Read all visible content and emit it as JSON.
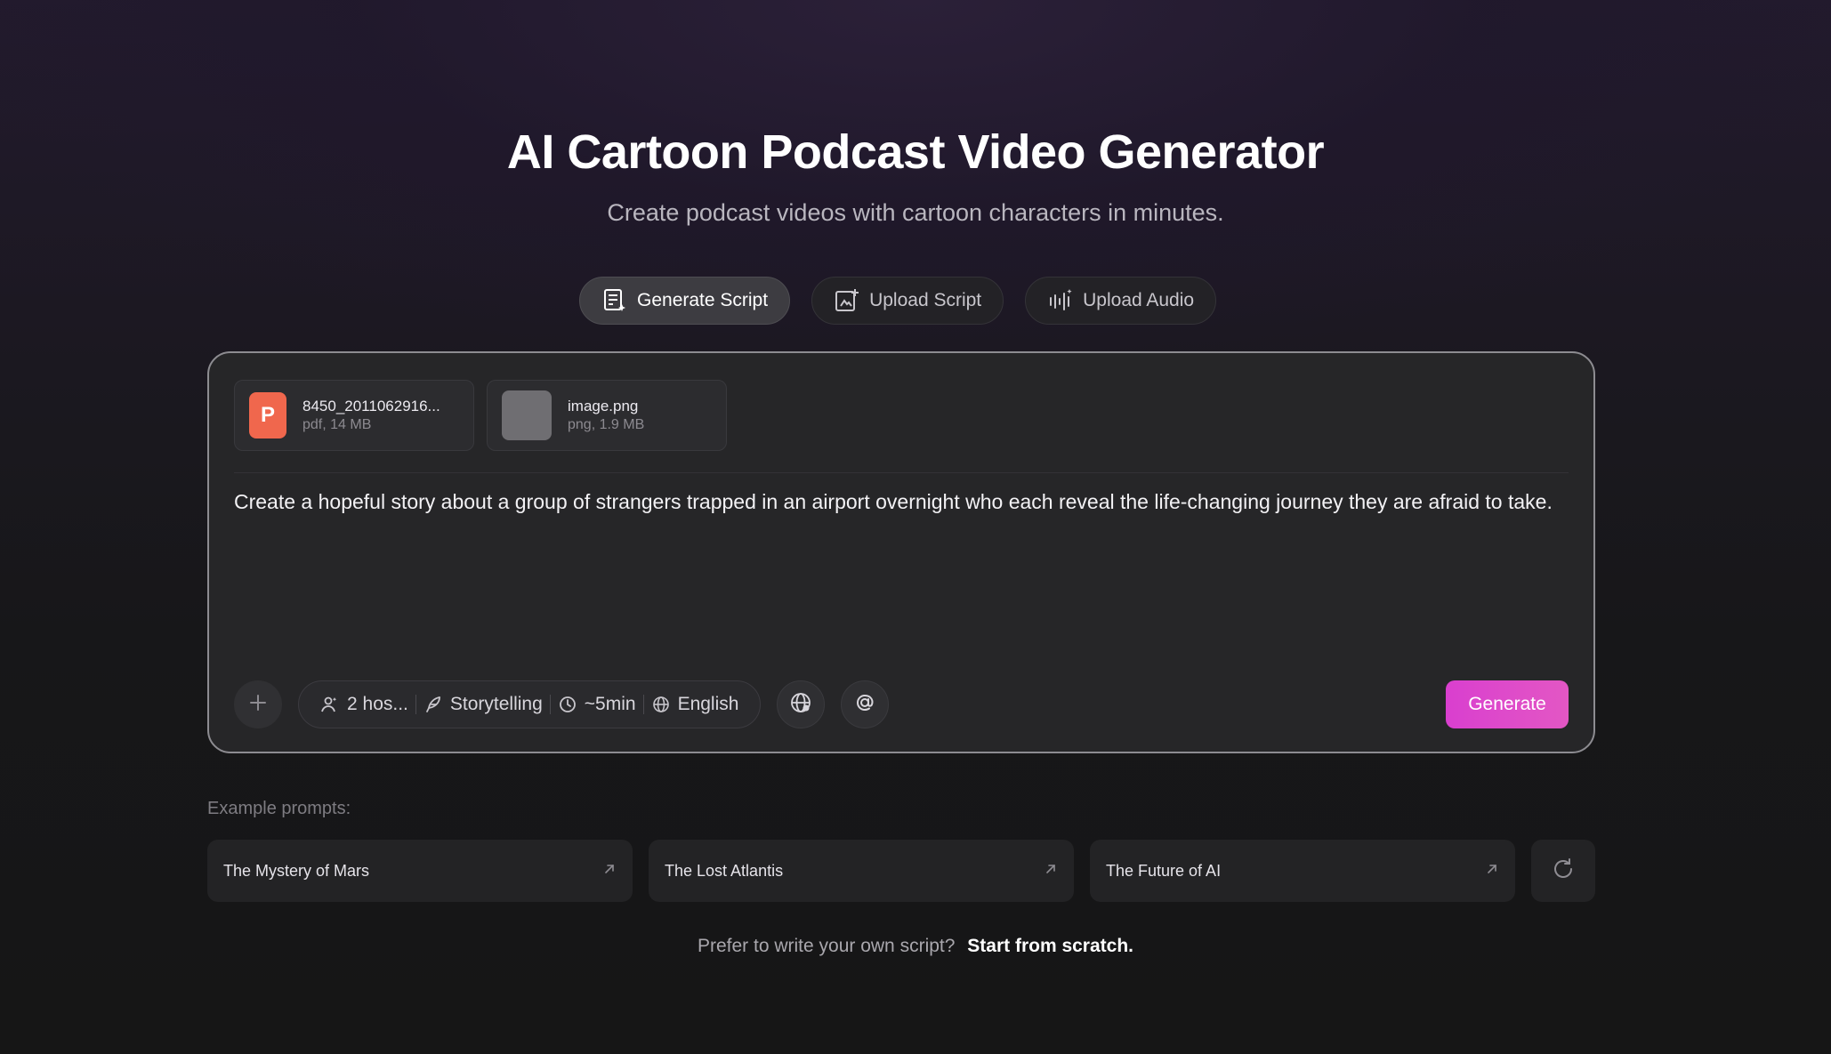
{
  "header": {
    "title": "AI Cartoon Podcast Video Generator",
    "subtitle": "Create podcast videos with cartoon characters in minutes."
  },
  "tabs": [
    {
      "label": "Generate Script",
      "icon": "script-sparkle-icon",
      "active": true
    },
    {
      "label": "Upload Script",
      "icon": "upload-document-icon",
      "active": false
    },
    {
      "label": "Upload Audio",
      "icon": "audio-wave-icon",
      "active": false
    }
  ],
  "attachments": [
    {
      "thumb": "P",
      "name": "8450_2011062916...",
      "info": "pdf, 14 MB",
      "icon": "pdf-file-icon"
    },
    {
      "thumb": "",
      "name": "image.png",
      "info": "png, 1.9 MB",
      "icon": "image-file-icon"
    }
  ],
  "prompt": {
    "text": "Create a hopeful story about a group of strangers trapped in an airport overnight who each reveal the life-changing journey they are afraid to take."
  },
  "options": {
    "hosts": "2 hos...",
    "style": "Storytelling",
    "duration": "~5min",
    "language": "English"
  },
  "generate_label": "Generate",
  "examples": {
    "label": "Example prompts:",
    "items": [
      "The Mystery of Mars",
      "The Lost Atlantis",
      "The Future of AI"
    ]
  },
  "footer": {
    "text": "Prefer to write your own script?",
    "link": "Start from scratch."
  },
  "colors": {
    "accent": "#de4bca",
    "pdf": "#f0674d"
  }
}
